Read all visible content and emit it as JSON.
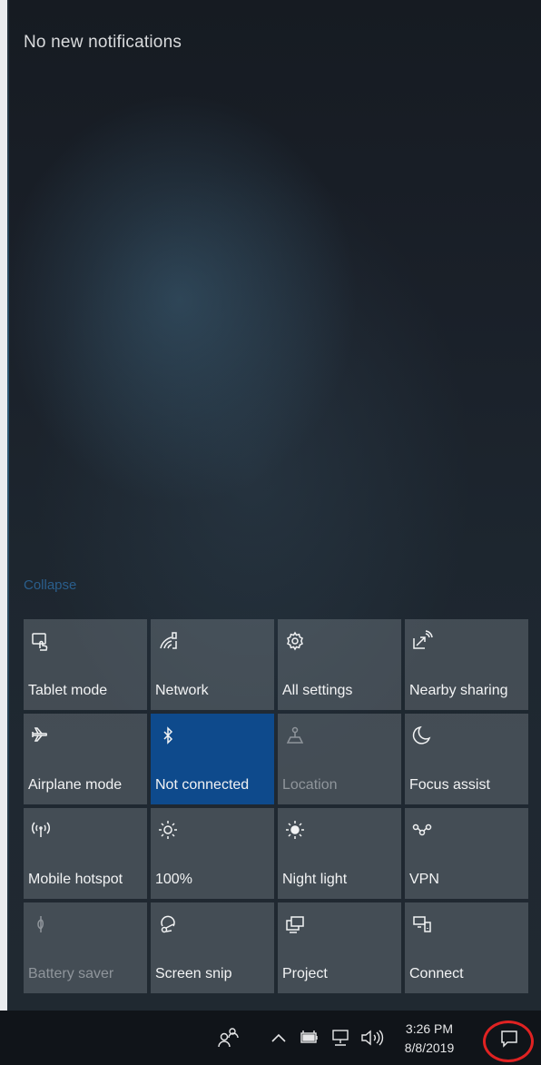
{
  "action_center": {
    "header": "No new notifications",
    "collapse_label": "Collapse",
    "quick_actions": [
      {
        "label": "Tablet mode",
        "icon": "tablet-mode-icon",
        "state": "off"
      },
      {
        "label": "Network",
        "icon": "network-icon",
        "state": "off"
      },
      {
        "label": "All settings",
        "icon": "gear-icon",
        "state": "off"
      },
      {
        "label": "Nearby sharing",
        "icon": "nearby-sharing-icon",
        "state": "off"
      },
      {
        "label": "Airplane mode",
        "icon": "airplane-icon",
        "state": "off"
      },
      {
        "label": "Not connected",
        "icon": "bluetooth-icon",
        "state": "on"
      },
      {
        "label": "Location",
        "icon": "location-icon",
        "state": "disabled"
      },
      {
        "label": "Focus assist",
        "icon": "moon-icon",
        "state": "off"
      },
      {
        "label": "Mobile hotspot",
        "icon": "hotspot-icon",
        "state": "off"
      },
      {
        "label": "100%",
        "icon": "brightness-icon",
        "state": "off"
      },
      {
        "label": "Night light",
        "icon": "night-light-icon",
        "state": "off"
      },
      {
        "label": "VPN",
        "icon": "vpn-icon",
        "state": "off"
      },
      {
        "label": "Battery saver",
        "icon": "battery-saver-icon",
        "state": "disabled"
      },
      {
        "label": "Screen snip",
        "icon": "screen-snip-icon",
        "state": "off"
      },
      {
        "label": "Project",
        "icon": "project-icon",
        "state": "off"
      },
      {
        "label": "Connect",
        "icon": "connect-icon",
        "state": "off"
      }
    ]
  },
  "taskbar": {
    "time": "3:26 PM",
    "date": "8/8/2019",
    "tray_icons": [
      "people-icon",
      "chevron-up-icon",
      "battery-icon",
      "network-tray-icon",
      "volume-icon",
      "action-center-icon"
    ]
  },
  "colors": {
    "active_tile": "#0e4a8c",
    "highlight_ring": "#e02222",
    "collapse_link": "#2a5e8c"
  }
}
